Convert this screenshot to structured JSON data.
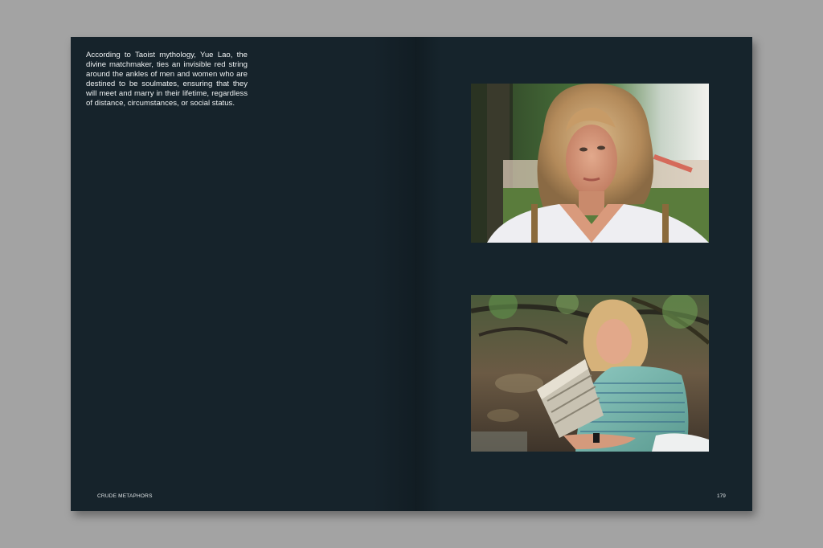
{
  "left_page": {
    "body_text": "According to Taoist mythology, Yue Lao, the divine matchmaker, ties an invisible red string around the ankles of men and women who are destined to be soulmates, ensuring that they will meet and marry in their lifetime, regardless of distance, circumstances, or social status.",
    "running_footer": "CRUDE METAPHORS"
  },
  "right_page": {
    "page_number": "179"
  },
  "colors": {
    "page_background": "#16232b",
    "surround": "#a3a3a3",
    "text": "#eef1f2"
  }
}
